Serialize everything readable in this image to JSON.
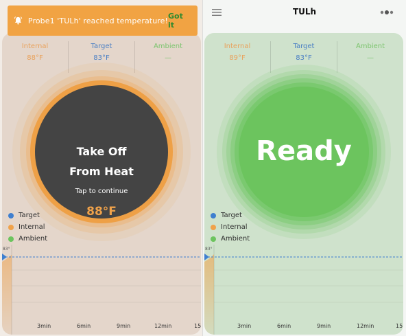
{
  "notification": {
    "text": "Probe1 'TULh' reached temperature!",
    "action": "Got it"
  },
  "header": {
    "title": "TULh"
  },
  "colors": {
    "internal": "#f0a24a",
    "target": "#3f7fcf",
    "ambient": "#6cc45e",
    "alert_banner": "#f1a343",
    "dial_dark": "#444444",
    "ready_green": "#6cc45e"
  },
  "left": {
    "readings": [
      {
        "label": "Internal",
        "value": "88°F",
        "color": "#e9a25c"
      },
      {
        "label": "Target",
        "value": "83°F",
        "color": "#4a7fc4"
      },
      {
        "label": "Ambient",
        "value": "—",
        "color": "#7cc46e"
      }
    ],
    "dial": {
      "line1": "Take Off",
      "line2": "From Heat",
      "subtitle": "Tap to continue",
      "temperature": "88°F"
    },
    "legend": [
      "Target",
      "Internal",
      "Ambient"
    ],
    "chart": {
      "y_tick": "83°",
      "x_labels": [
        "3min",
        "6min",
        "9min",
        "12min",
        "15"
      ]
    }
  },
  "right": {
    "readings": [
      {
        "label": "Internal",
        "value": "89°F",
        "color": "#e9a25c"
      },
      {
        "label": "Target",
        "value": "83°F",
        "color": "#4a7fc4"
      },
      {
        "label": "Ambient",
        "value": "—",
        "color": "#7cc46e"
      }
    ],
    "dial": {
      "status": "Ready"
    },
    "legend": [
      "Target",
      "Internal",
      "Ambient"
    ],
    "chart": {
      "y_tick": "83°",
      "x_labels": [
        "3min",
        "6min",
        "9min",
        "12min",
        "15"
      ]
    }
  }
}
